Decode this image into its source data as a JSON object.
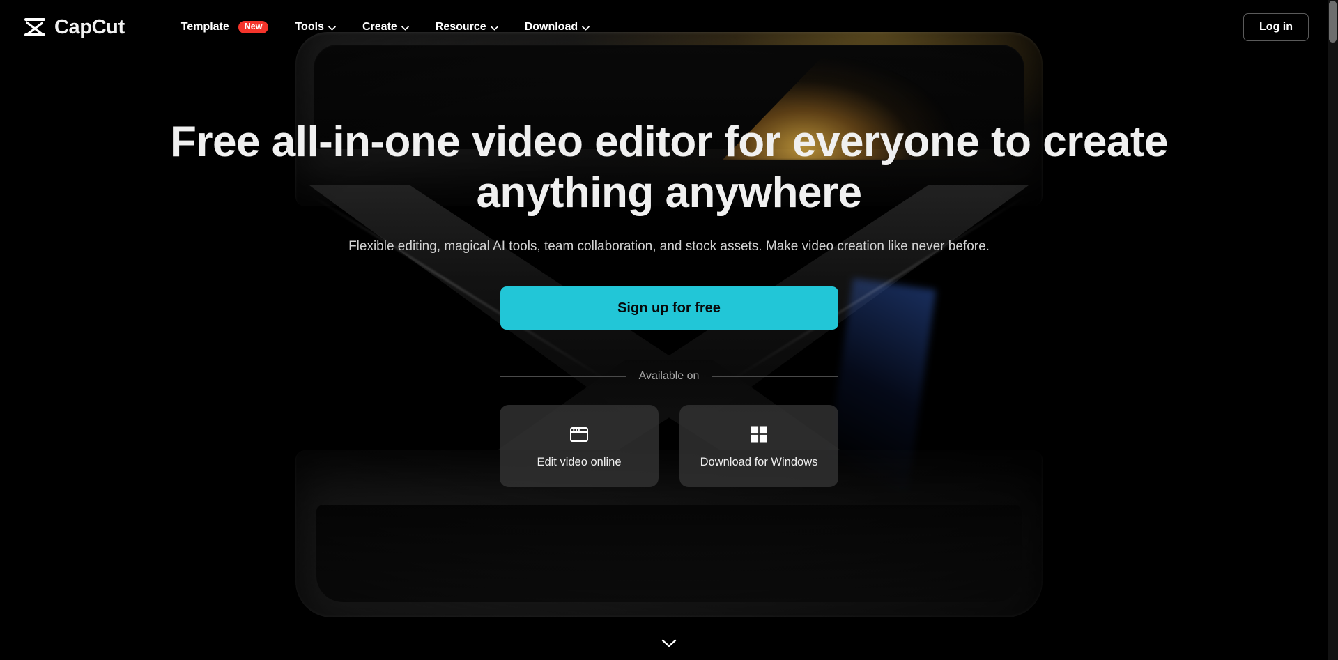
{
  "theme": {
    "background": "#000000",
    "accent": "#22c6d7",
    "badge": "#f5342b",
    "text_primary": "#f0f0f0",
    "text_secondary": "#d2d2d2",
    "card_background": "#343434"
  },
  "header": {
    "logo": {
      "icon": "capcut-logo-icon",
      "name": "CapCut"
    },
    "nav_items": [
      {
        "label": "Template",
        "badge": "New",
        "has_chevron": false
      },
      {
        "label": "Tools",
        "badge": "",
        "has_chevron": true
      },
      {
        "label": "Create",
        "badge": "",
        "has_chevron": true
      },
      {
        "label": "Resource",
        "badge": "",
        "has_chevron": true
      },
      {
        "label": "Download",
        "badge": "",
        "has_chevron": true
      }
    ],
    "login_label": "Log in"
  },
  "hero": {
    "headline": "Free all-in-one video editor for everyone to create anything anywhere",
    "subhead": "Flexible editing, magical AI tools, team collaboration, and stock assets. Make video creation like never before.",
    "cta_label": "Sign up for free",
    "available_label": "Available on",
    "platforms": [
      {
        "icon": "browser-window-icon",
        "label": "Edit video online"
      },
      {
        "icon": "windows-logo-icon",
        "label": "Download for Windows"
      }
    ],
    "scroll_hint_icon": "chevron-down-icon"
  }
}
